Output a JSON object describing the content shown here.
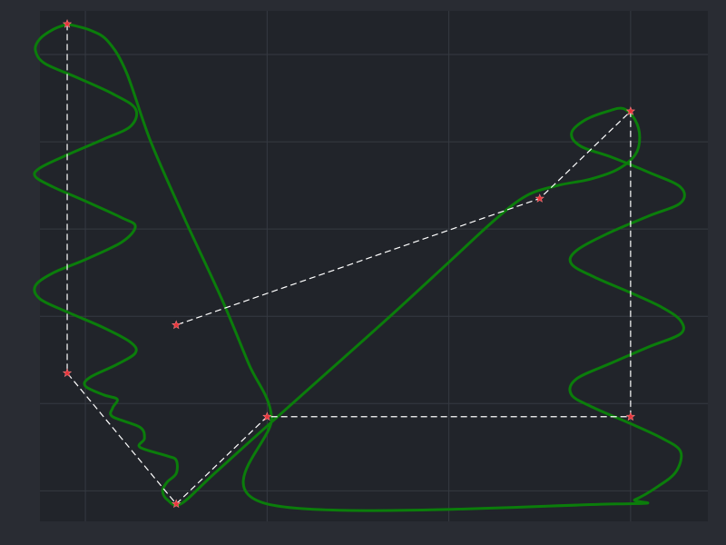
{
  "chart_data": {
    "type": "line",
    "title": "",
    "xlabel": "",
    "ylabel": "",
    "xlim": [
      -0.5,
      6.85
    ],
    "ylim": [
      -1.35,
      4.5
    ],
    "grid": true,
    "colors": {
      "figure_bg": "#292c33",
      "plot_bg": "#21242a",
      "grid": "#363a42",
      "path": "#0b7d0b",
      "waypoint_line": "#ffffff",
      "waypoint_marker": "#e8343a"
    },
    "series": [
      {
        "role": "waypoints",
        "marker": "star",
        "linestyle": "dashed",
        "points": [
          [
            -0.2,
            4.35
          ],
          [
            -0.2,
            0.35
          ],
          [
            1.0,
            -1.15
          ],
          [
            2.0,
            -0.15
          ],
          [
            6.0,
            -0.15
          ],
          [
            6.0,
            3.35
          ],
          [
            5.0,
            2.35
          ],
          [
            1.0,
            0.9
          ]
        ]
      },
      {
        "role": "trajectory",
        "linestyle": "solid",
        "points": [
          [
            -0.2,
            4.35
          ],
          [
            -0.35,
            4.29
          ],
          [
            -0.5,
            4.18
          ],
          [
            -0.55,
            4.05
          ],
          [
            -0.45,
            3.9
          ],
          [
            -0.1,
            3.74
          ],
          [
            0.3,
            3.55
          ],
          [
            0.55,
            3.38
          ],
          [
            0.5,
            3.18
          ],
          [
            0.2,
            3.03
          ],
          [
            -0.2,
            2.85
          ],
          [
            -0.5,
            2.7
          ],
          [
            -0.55,
            2.6
          ],
          [
            -0.35,
            2.48
          ],
          [
            0.0,
            2.32
          ],
          [
            0.4,
            2.13
          ],
          [
            0.55,
            2.03
          ],
          [
            0.4,
            1.85
          ],
          [
            0.0,
            1.65
          ],
          [
            -0.35,
            1.5
          ],
          [
            -0.55,
            1.35
          ],
          [
            -0.5,
            1.2
          ],
          [
            -0.2,
            1.05
          ],
          [
            0.2,
            0.87
          ],
          [
            0.5,
            0.7
          ],
          [
            0.55,
            0.58
          ],
          [
            0.35,
            0.45
          ],
          [
            0.05,
            0.3
          ],
          [
            0.0,
            0.2
          ],
          [
            0.2,
            0.1
          ],
          [
            0.35,
            0.05
          ],
          [
            0.3,
            -0.05
          ],
          [
            0.3,
            -0.15
          ],
          [
            0.6,
            -0.27
          ],
          [
            0.65,
            -0.4
          ],
          [
            0.6,
            -0.5
          ],
          [
            0.9,
            -0.6
          ],
          [
            1.0,
            -0.65
          ],
          [
            1.0,
            -0.8
          ],
          [
            0.9,
            -0.9
          ],
          [
            0.85,
            -1.0
          ],
          [
            0.9,
            -1.1
          ],
          [
            1.05,
            -1.15
          ],
          [
            1.4,
            -0.82
          ],
          [
            1.9,
            -0.35
          ],
          [
            2.6,
            0.3
          ],
          [
            3.3,
            0.95
          ],
          [
            4.0,
            1.62
          ],
          [
            4.5,
            2.1
          ],
          [
            4.85,
            2.38
          ],
          [
            5.2,
            2.5
          ],
          [
            5.55,
            2.57
          ],
          [
            5.85,
            2.68
          ],
          [
            6.05,
            2.85
          ],
          [
            6.1,
            3.05
          ],
          [
            6.05,
            3.25
          ],
          [
            5.92,
            3.38
          ],
          [
            5.75,
            3.35
          ],
          [
            5.5,
            3.25
          ],
          [
            5.35,
            3.1
          ],
          [
            5.45,
            2.95
          ],
          [
            5.8,
            2.82
          ],
          [
            6.2,
            2.65
          ],
          [
            6.55,
            2.48
          ],
          [
            6.55,
            2.3
          ],
          [
            6.2,
            2.15
          ],
          [
            5.75,
            1.95
          ],
          [
            5.4,
            1.75
          ],
          [
            5.35,
            1.6
          ],
          [
            5.6,
            1.45
          ],
          [
            6.0,
            1.27
          ],
          [
            6.35,
            1.1
          ],
          [
            6.55,
            0.95
          ],
          [
            6.55,
            0.8
          ],
          [
            6.2,
            0.65
          ],
          [
            5.8,
            0.47
          ],
          [
            5.4,
            0.28
          ],
          [
            5.35,
            0.1
          ],
          [
            5.6,
            -0.05
          ],
          [
            6.0,
            -0.23
          ],
          [
            6.35,
            -0.4
          ],
          [
            6.55,
            -0.55
          ],
          [
            6.5,
            -0.78
          ],
          [
            6.3,
            -0.95
          ],
          [
            6.05,
            -1.1
          ],
          [
            5.85,
            -1.15
          ],
          [
            2.0,
            -1.15
          ],
          [
            2.05,
            -0.15
          ],
          [
            1.8,
            0.45
          ],
          [
            1.5,
            1.2
          ],
          [
            1.1,
            2.1
          ],
          [
            0.72,
            3.0
          ],
          [
            0.45,
            3.8
          ],
          [
            0.25,
            4.15
          ],
          [
            0.05,
            4.28
          ],
          [
            -0.2,
            4.35
          ]
        ]
      }
    ]
  }
}
